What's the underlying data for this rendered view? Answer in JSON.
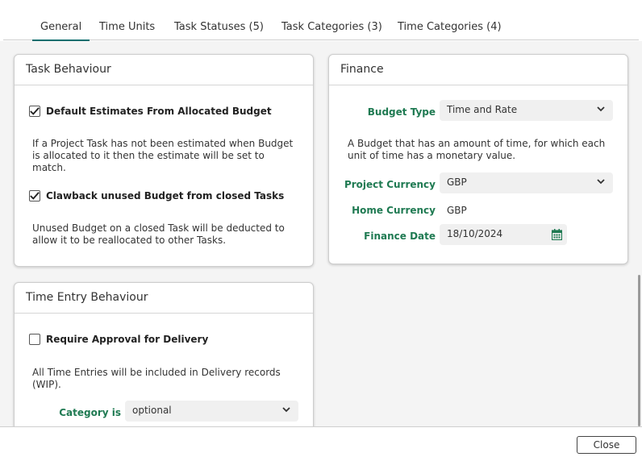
{
  "tabs": [
    {
      "label": "General",
      "active": true
    },
    {
      "label": "Time Units"
    },
    {
      "label": "Task Statuses (5)"
    },
    {
      "label": "Task Categories (3)"
    },
    {
      "label": "Time Categories (4)"
    }
  ],
  "task_behaviour": {
    "title": "Task Behaviour",
    "default_estimates": {
      "label": "Default Estimates From Allocated Budget",
      "checked": true,
      "description": "If a Project Task has not been estimated when Budget is allocated to it then the estimate will be set to match."
    },
    "clawback": {
      "label": "Clawback unused Budget from closed Tasks",
      "checked": true,
      "description": "Unused Budget on a closed Task will be deducted to allow it to be reallocated to other Tasks."
    }
  },
  "time_entry_behaviour": {
    "title": "Time Entry Behaviour",
    "require_approval": {
      "label": "Require Approval for Delivery",
      "checked": false,
      "description": "All Time Entries will be included in Delivery records (WIP)."
    },
    "category_label": "Category is",
    "category_value": "optional"
  },
  "finance": {
    "title": "Finance",
    "budget_type_label": "Budget Type",
    "budget_type_value": "Time and Rate",
    "budget_type_description": "A Budget that has an amount of time, for which each unit of time has a monetary value.",
    "project_currency_label": "Project Currency",
    "project_currency_value": "GBP",
    "home_currency_label": "Home Currency",
    "home_currency_value": "GBP",
    "finance_date_label": "Finance Date",
    "finance_date_value": "18/10/2024"
  },
  "footer": {
    "close_label": "Close"
  },
  "colors": {
    "accent": "#0d6e6e",
    "label_green": "#1f7a52"
  }
}
